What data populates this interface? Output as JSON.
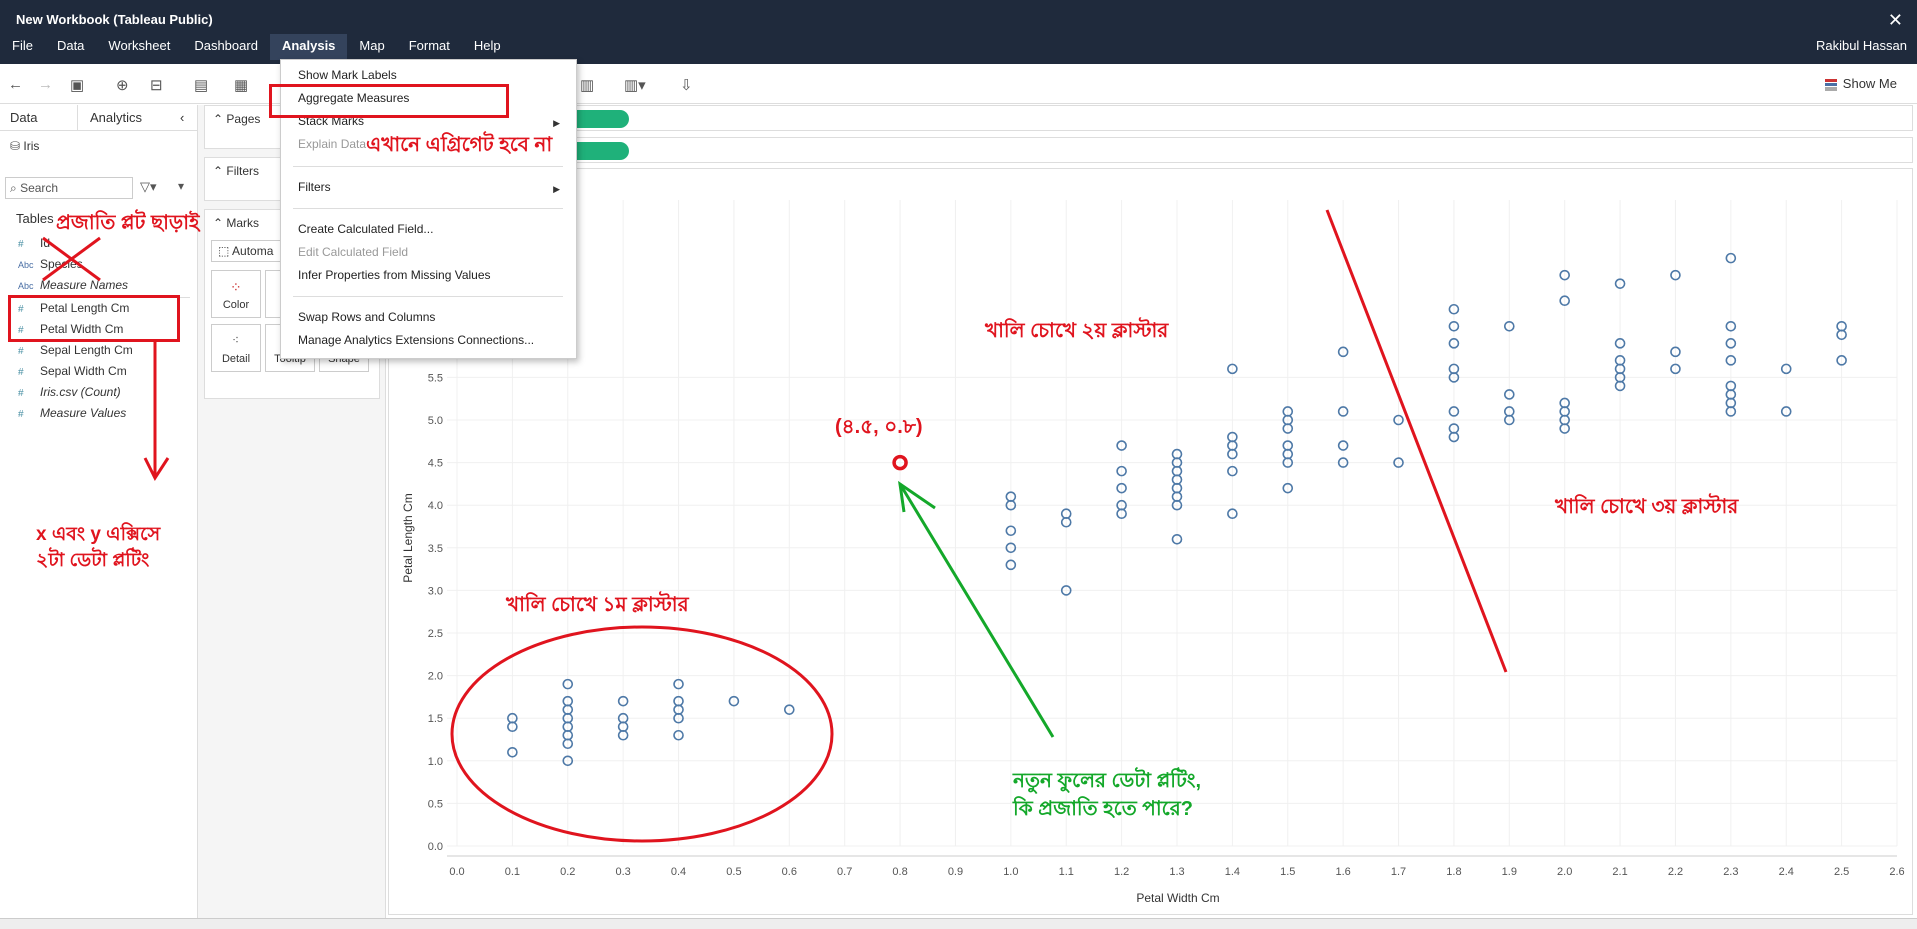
{
  "window": {
    "title": "New Workbook (Tableau Public)",
    "close_glyph": "✕",
    "user": "Rakibul Hassan"
  },
  "menu": [
    "File",
    "Data",
    "Worksheet",
    "Dashboard",
    "Analysis",
    "Map",
    "Format",
    "Help"
  ],
  "toolbar": {
    "show_me": "Show Me"
  },
  "left_panel": {
    "tabs": [
      "Data",
      "Analytics"
    ],
    "datasource": "Iris",
    "search_placeholder": "Search",
    "tables_heading": "Tables",
    "fields": [
      {
        "name": "Id",
        "type": "#"
      },
      {
        "name": "Species",
        "type": "Abc"
      },
      {
        "name": "Measure Names",
        "type": "Abc",
        "italic": true
      },
      {
        "name": "Petal Length Cm",
        "type": "#"
      },
      {
        "name": "Petal Width Cm",
        "type": "#"
      },
      {
        "name": "Sepal Length Cm",
        "type": "#"
      },
      {
        "name": "Sepal Width Cm",
        "type": "#"
      },
      {
        "name": "Iris.csv (Count)",
        "type": "#",
        "italic": true
      },
      {
        "name": "Measure Values",
        "type": "#",
        "italic": true
      }
    ]
  },
  "mid_panel": {
    "pages": "Pages",
    "filters": "Filters",
    "marks": "Marks",
    "mark_type": "Automa",
    "buttons": [
      "Color",
      "Detail",
      "Tooltip",
      "Shape"
    ]
  },
  "analysis_menu": {
    "items": [
      {
        "label": "Show Mark Labels",
        "disabled": false
      },
      {
        "label": "Aggregate Measures",
        "disabled": false
      },
      {
        "label": "Stack Marks",
        "disabled": false,
        "submenu": true
      },
      {
        "label": "Explain Data",
        "disabled": true
      },
      {
        "label": "Filters",
        "disabled": false,
        "submenu": true
      },
      {
        "label": "Create Calculated Field...",
        "disabled": false
      },
      {
        "label": "Edit Calculated Field",
        "disabled": true
      },
      {
        "label": "Infer Properties from Missing Values",
        "disabled": false
      },
      {
        "label": "Swap Rows and Columns",
        "disabled": false
      },
      {
        "label": "Manage Analytics Extensions Connections...",
        "disabled": false
      }
    ]
  },
  "annotations": {
    "no_aggregate": "এখানে এগ্রিগেট হবে না",
    "species_no_plot": "প্রজাতি প্লট ছাড়াই",
    "xy_plot": [
      "x এবং y এক্সিসে",
      "২টা ডেটা প্লটিং"
    ],
    "cluster1": "খালি চোখে ১ম ক্লাস্টার",
    "cluster2": "খালি চোখে ২য় ক্লাস্টার",
    "cluster3": "খালি চোখে ৩য় ক্লাস্টার",
    "new_point_label": "(৪.৫, ০.৮)",
    "new_flower": [
      "নতুন ফুলের ডেটা প্লটিং,",
      "কি প্রজাতি হতে পারে?"
    ]
  },
  "colors": {
    "marks": "#4e79a7",
    "annotation_red": "#e0141e",
    "annotation_green": "#14a82a",
    "pill": "#1fb17a"
  },
  "chart_data": {
    "type": "scatter",
    "xlabel": "Petal Width Cm",
    "ylabel": "Petal Length Cm",
    "xlim": [
      0.0,
      2.6
    ],
    "ylim": [
      0.0,
      7.0
    ],
    "xticks": [
      0.0,
      0.1,
      0.2,
      0.3,
      0.4,
      0.5,
      0.6,
      0.7,
      0.8,
      0.9,
      1.0,
      1.1,
      1.2,
      1.3,
      1.4,
      1.5,
      1.6,
      1.7,
      1.8,
      1.9,
      2.0,
      2.1,
      2.2,
      2.3,
      2.4,
      2.5,
      2.6
    ],
    "yticks": [
      0.0,
      0.5,
      1.0,
      1.5,
      2.0,
      2.5,
      3.0,
      3.5,
      4.0,
      4.5,
      5.0,
      5.5
    ],
    "points": [
      [
        0.1,
        1.5
      ],
      [
        0.1,
        1.4
      ],
      [
        0.1,
        1.1
      ],
      [
        0.2,
        1.9
      ],
      [
        0.2,
        1.7
      ],
      [
        0.2,
        1.6
      ],
      [
        0.2,
        1.5
      ],
      [
        0.2,
        1.4
      ],
      [
        0.2,
        1.3
      ],
      [
        0.2,
        1.2
      ],
      [
        0.2,
        1.0
      ],
      [
        0.3,
        1.7
      ],
      [
        0.3,
        1.5
      ],
      [
        0.3,
        1.4
      ],
      [
        0.3,
        1.3
      ],
      [
        0.4,
        1.9
      ],
      [
        0.4,
        1.7
      ],
      [
        0.4,
        1.6
      ],
      [
        0.4,
        1.5
      ],
      [
        0.4,
        1.3
      ],
      [
        0.5,
        1.7
      ],
      [
        0.6,
        1.6
      ],
      [
        1.0,
        4.1
      ],
      [
        1.0,
        4.0
      ],
      [
        1.0,
        3.7
      ],
      [
        1.0,
        3.5
      ],
      [
        1.0,
        3.3
      ],
      [
        1.1,
        3.9
      ],
      [
        1.1,
        3.8
      ],
      [
        1.1,
        3.0
      ],
      [
        1.2,
        4.7
      ],
      [
        1.2,
        4.4
      ],
      [
        1.2,
        4.2
      ],
      [
        1.2,
        4.0
      ],
      [
        1.2,
        3.9
      ],
      [
        1.3,
        4.6
      ],
      [
        1.3,
        4.5
      ],
      [
        1.3,
        4.4
      ],
      [
        1.3,
        4.3
      ],
      [
        1.3,
        4.2
      ],
      [
        1.3,
        4.1
      ],
      [
        1.3,
        4.0
      ],
      [
        1.3,
        3.6
      ],
      [
        1.4,
        5.6
      ],
      [
        1.4,
        4.8
      ],
      [
        1.4,
        4.7
      ],
      [
        1.4,
        4.6
      ],
      [
        1.4,
        4.4
      ],
      [
        1.4,
        3.9
      ],
      [
        1.5,
        5.1
      ],
      [
        1.5,
        5.0
      ],
      [
        1.5,
        4.9
      ],
      [
        1.5,
        4.7
      ],
      [
        1.5,
        4.6
      ],
      [
        1.5,
        4.5
      ],
      [
        1.5,
        4.2
      ],
      [
        1.6,
        5.8
      ],
      [
        1.6,
        5.1
      ],
      [
        1.6,
        4.7
      ],
      [
        1.6,
        4.5
      ],
      [
        1.7,
        5.0
      ],
      [
        1.7,
        4.5
      ],
      [
        1.8,
        6.3
      ],
      [
        1.8,
        6.1
      ],
      [
        1.8,
        5.9
      ],
      [
        1.8,
        5.6
      ],
      [
        1.8,
        5.5
      ],
      [
        1.8,
        5.1
      ],
      [
        1.8,
        4.9
      ],
      [
        1.8,
        4.8
      ],
      [
        1.9,
        6.1
      ],
      [
        1.9,
        5.3
      ],
      [
        1.9,
        5.1
      ],
      [
        1.9,
        5.0
      ],
      [
        2.0,
        6.7
      ],
      [
        2.0,
        6.4
      ],
      [
        2.0,
        5.2
      ],
      [
        2.0,
        5.1
      ],
      [
        2.0,
        5.0
      ],
      [
        2.0,
        4.9
      ],
      [
        2.1,
        6.6
      ],
      [
        2.1,
        5.9
      ],
      [
        2.1,
        5.7
      ],
      [
        2.1,
        5.6
      ],
      [
        2.1,
        5.5
      ],
      [
        2.1,
        5.4
      ],
      [
        2.2,
        6.7
      ],
      [
        2.2,
        5.8
      ],
      [
        2.2,
        5.6
      ],
      [
        2.3,
        6.9
      ],
      [
        2.3,
        6.1
      ],
      [
        2.3,
        5.9
      ],
      [
        2.3,
        5.7
      ],
      [
        2.3,
        5.4
      ],
      [
        2.3,
        5.3
      ],
      [
        2.3,
        5.2
      ],
      [
        2.3,
        5.1
      ],
      [
        2.4,
        5.6
      ],
      [
        2.4,
        5.1
      ],
      [
        2.5,
        6.1
      ],
      [
        2.5,
        6.0
      ],
      [
        2.5,
        5.7
      ]
    ],
    "highlight_point": [
      0.8,
      4.5
    ]
  }
}
